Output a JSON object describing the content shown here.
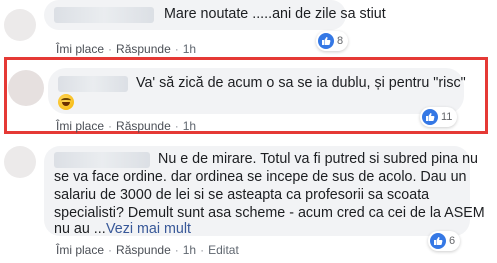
{
  "comments": [
    {
      "text": "Mare noutate .....ani de zile sa stiut",
      "like_label": "Îmi place",
      "reply_label": "Răspunde",
      "time": "1h",
      "reaction_count": "8"
    },
    {
      "text": "Va' să zică de acum o sa se ia dublu, și pentru \"risc\"",
      "like_label": "Îmi place",
      "reply_label": "Răspunde",
      "time": "1h",
      "reaction_count": "11"
    },
    {
      "text_lines": [
        "Nu e de mirare. Totul va fi putred si subred pina nu",
        "se va face ordine. dar ordinea se incepe de sus de acolo. Dau un",
        "salariu de 3000 de lei si se asteapta ca profesorii sa scoata",
        "specialisti? Demult sunt asa scheme - acum cred ca cei de la ASEM",
        "nu au ..."
      ],
      "see_more_label": "Vezi mai mult",
      "like_label": "Îmi place",
      "reply_label": "Răspunde",
      "time": "1h",
      "edited_label": "Editat",
      "reaction_count": "6"
    }
  ],
  "colors": {
    "highlight": "#e53935",
    "like_blue": "#3578e5",
    "bubble": "#f2f3f5"
  }
}
